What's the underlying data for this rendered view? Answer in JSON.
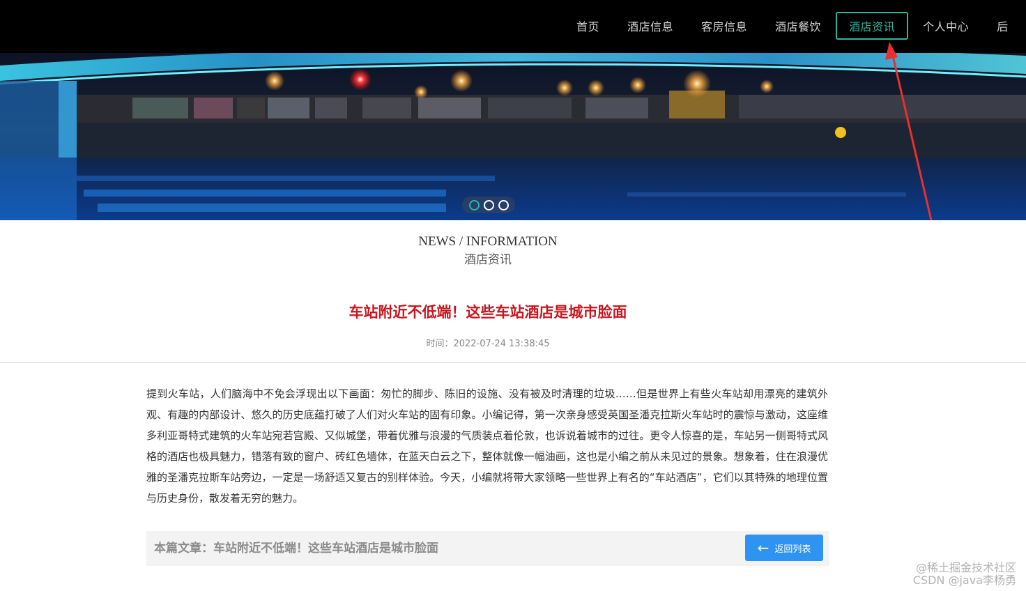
{
  "nav": {
    "items": [
      {
        "label": "首页"
      },
      {
        "label": "酒店信息"
      },
      {
        "label": "客房信息"
      },
      {
        "label": "酒店餐饮"
      },
      {
        "label": "酒店资讯"
      },
      {
        "label": "个人中心"
      },
      {
        "label": "后"
      }
    ],
    "active_index": 4
  },
  "banner": {
    "slide_count": 3,
    "active_slide": 1
  },
  "section": {
    "title_en": "NEWS / INFORMATION",
    "title_cn": "酒店资讯"
  },
  "article": {
    "title": "车站附近不低端！这些车站酒店是城市脸面",
    "time_text": "时间：2022-07-24 13:38:45",
    "body": "提到火车站，人们脑海中不免会浮现出以下画面：匆忙的脚步、陈旧的设施、没有被及时清理的垃圾……但是世界上有些火车站却用漂亮的建筑外观、有趣的内部设计、悠久的历史底蕴打破了人们对火车站的固有印象。小编记得，第一次亲身感受英国圣潘克拉斯火车站时的震惊与激动，这座维多利亚哥特式建筑的火车站宛若宫殿、又似城堡，带着优雅与浪漫的气质装点着伦敦，也诉说着城市的过往。更令人惊喜的是，车站另一侧哥特式风格的酒店也极具魅力，错落有致的窗户、砖红色墙体，在蓝天白云之下，整体就像一幅油画，这也是小编之前从未见过的景象。想象着，住在浪漫优雅的圣潘克拉斯车站旁边，一定是一场舒适又复古的别样体验。今天，小编就将带大家领略一些世界上有名的“车站酒店”，它们以其特殊的地理位置与历史身份，散发着无穷的魅力。"
  },
  "footer": {
    "current_article": "本篇文章：车站附近不低端！这些车站酒店是城市脸面",
    "back_button": "返回列表",
    "back_icon": "arrow-left-icon"
  },
  "watermark": {
    "line1": "@稀土掘金技术社区",
    "line2": "CSDN @java李杨勇"
  },
  "colors": {
    "nav_bg": "#000000",
    "accent": "#2fb79d",
    "title_red": "#c8161d",
    "button_blue": "#2f93f1",
    "annotation_red": "#e8302e"
  }
}
